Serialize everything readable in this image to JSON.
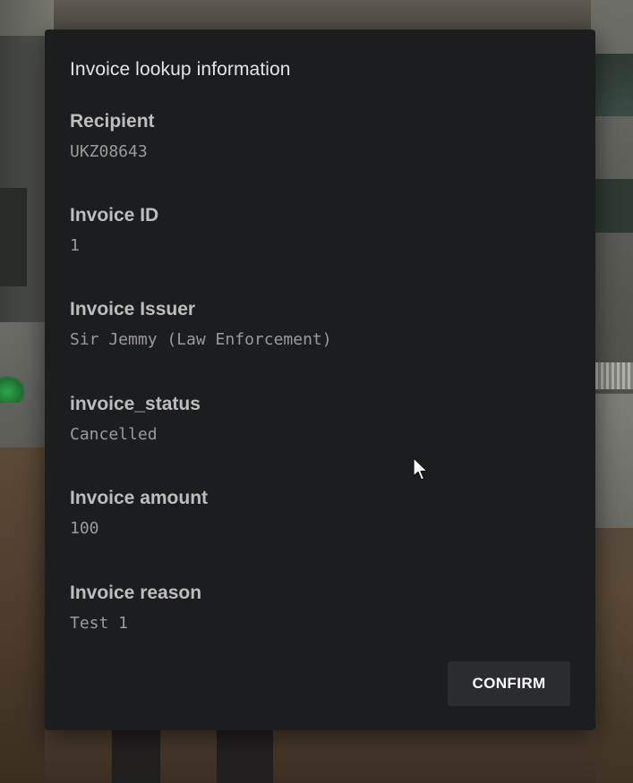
{
  "dialog": {
    "title": "Invoice lookup information",
    "fields": [
      {
        "label": "Recipient",
        "value": "UKZ08643"
      },
      {
        "label": "Invoice ID",
        "value": "1"
      },
      {
        "label": "Invoice Issuer",
        "value": "Sir Jemmy (Law Enforcement)"
      },
      {
        "label": "invoice_status",
        "value": "Cancelled"
      },
      {
        "label": "Invoice amount",
        "value": "100"
      },
      {
        "label": "Invoice reason",
        "value": "Test 1"
      }
    ],
    "confirm_label": "CONFIRM"
  },
  "cursor": {
    "icon": "mouse-pointer-icon"
  },
  "colors": {
    "dialog_background": "#1c1d1f",
    "title_text": "#e4e4e4",
    "label_text": "#bdbdbd",
    "value_text": "#9a9a9a",
    "button_background": "#2a2c2f",
    "button_text": "#ffffff"
  }
}
